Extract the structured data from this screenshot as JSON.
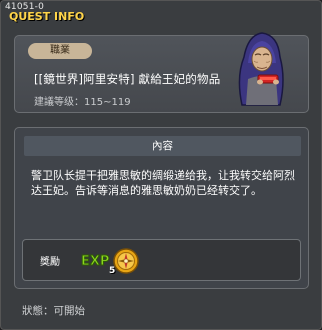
{
  "window": {
    "quest_id": "41051-0",
    "title": "QUEST INFO"
  },
  "header": {
    "job_badge": "職業",
    "quest_name": "[[鏡世界]阿里安特] 獻給王妃的物品",
    "level_requirement": "建議等级：115~119"
  },
  "content": {
    "section_title": "內容",
    "description": "警卫队长提干把雅思敏的绸缎递给我，让我转交给阿烈达王妃。告诉等消息的雅思敏奶奶已经转交了。"
  },
  "rewards": {
    "label": "獎勵",
    "exp_label": "EXP",
    "item_icon": "gold-compass-coin-icon",
    "item_quantity": "5"
  },
  "status": "狀態：可開始",
  "colors": {
    "title_accent": "#ffd54a",
    "badge_bg": "#c8b598",
    "exp_green": "#8bd61e",
    "window_bg": "#3a3d40"
  }
}
